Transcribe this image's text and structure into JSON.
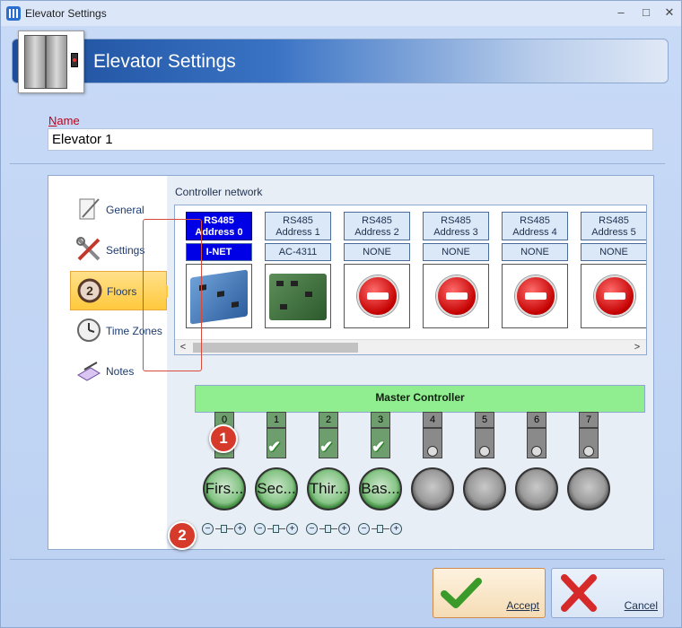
{
  "window": {
    "title": "Elevator Settings",
    "minimize": "–",
    "maximize": "□",
    "close": "✕"
  },
  "header": {
    "title": "Elevator Settings"
  },
  "name_field": {
    "label_first": "N",
    "label_rest": "ame",
    "value": "Elevator 1"
  },
  "nav": {
    "items": [
      {
        "label": "General",
        "icon": "document-pen-icon"
      },
      {
        "label": "Settings",
        "icon": "tools-icon"
      },
      {
        "label": "Floors",
        "icon": "floor-2-icon",
        "selected": true
      },
      {
        "label": "Time Zones",
        "icon": "clock-icon"
      },
      {
        "label": "Notes",
        "icon": "notes-icon"
      }
    ]
  },
  "controller_network": {
    "label": "Controller network",
    "controllers": [
      {
        "address_line1": "RS485",
        "address_line2": "Address 0",
        "type": "I-NET",
        "image": "inet-board",
        "selected": true
      },
      {
        "address_line1": "RS485",
        "address_line2": "Address 1",
        "type": "AC-4311",
        "image": "ac4311-board",
        "selected": false
      },
      {
        "address_line1": "RS485",
        "address_line2": "Address 2",
        "type": "NONE",
        "image": "no-entry",
        "selected": false
      },
      {
        "address_line1": "RS485",
        "address_line2": "Address 3",
        "type": "NONE",
        "image": "no-entry",
        "selected": false
      },
      {
        "address_line1": "RS485",
        "address_line2": "Address 4",
        "type": "NONE",
        "image": "no-entry",
        "selected": false
      },
      {
        "address_line1": "RS485",
        "address_line2": "Address 5",
        "type": "NONE",
        "image": "no-entry",
        "selected": false
      }
    ],
    "scroll_left": "<",
    "scroll_right": ">"
  },
  "master": {
    "title": "Master Controller"
  },
  "relays": [
    {
      "number": "0",
      "state": "on"
    },
    {
      "number": "1",
      "state": "on"
    },
    {
      "number": "2",
      "state": "on"
    },
    {
      "number": "3",
      "state": "on"
    },
    {
      "number": "4",
      "state": "off"
    },
    {
      "number": "5",
      "state": "off"
    },
    {
      "number": "6",
      "state": "off"
    },
    {
      "number": "7",
      "state": "off"
    }
  ],
  "floors": [
    {
      "label": "Firs...",
      "state": "on"
    },
    {
      "label": "Sec...",
      "state": "on"
    },
    {
      "label": "Thir...",
      "state": "on"
    },
    {
      "label": "Bas...",
      "state": "on"
    },
    {
      "label": "",
      "state": "off"
    },
    {
      "label": "",
      "state": "off"
    },
    {
      "label": "",
      "state": "off"
    },
    {
      "label": "",
      "state": "off"
    }
  ],
  "stepper": {
    "minus": "−",
    "plus": "+"
  },
  "badges": {
    "one": "1",
    "two": "2"
  },
  "buttons": {
    "accept": "Accept",
    "cancel": "Cancel"
  },
  "colors": {
    "accent_blue": "#0000e6",
    "master_green": "#90ee90",
    "badge_red": "#d63a2a"
  }
}
